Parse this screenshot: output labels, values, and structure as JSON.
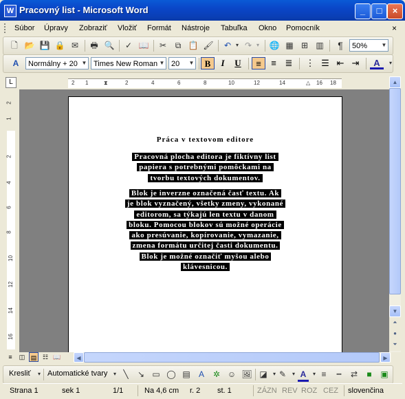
{
  "window": {
    "title": "Pracovný list - Microsoft Word",
    "app_icon": "W"
  },
  "menu": {
    "items": [
      {
        "label": "Súbor"
      },
      {
        "label": "Úpravy"
      },
      {
        "label": "Zobraziť"
      },
      {
        "label": "Vložiť"
      },
      {
        "label": "Formát"
      },
      {
        "label": "Nástroje"
      },
      {
        "label": "Tabuľka"
      },
      {
        "label": "Okno"
      },
      {
        "label": "Pomocník"
      }
    ],
    "close_doc": "×"
  },
  "standard_toolbar": {
    "zoom": "50%"
  },
  "formatting_toolbar": {
    "style": "Normálny + 20",
    "font": "Times New Roman",
    "size": "20",
    "bold": "B",
    "italic": "I",
    "underline": "U",
    "font_color": "#ff0000",
    "highlight_color": "#ffff00"
  },
  "ruler": {
    "h_ticks": [
      "2",
      "1",
      "2",
      "4",
      "6",
      "8",
      "10",
      "12",
      "14",
      "16",
      "18"
    ],
    "v_ticks": [
      "2",
      "1",
      "2",
      "4",
      "6",
      "8",
      "10",
      "12",
      "14",
      "16"
    ]
  },
  "document": {
    "title": "Práca v textovom editore",
    "para1": [
      "Pracovná plocha editora je fiktívny list",
      "papiera s potrebnými pomôckami na",
      "tvorbu textových dokumentov."
    ],
    "para2": [
      "Blok je inverzne označená časť textu. Ak",
      "je blok vyznačený, všetky zmeny, vykonané",
      "editorom, sa týkajú len textu v danom",
      "bloku. Pomocou blokov sú možné operácie",
      "ako presúvanie, kopírovanie, vymazanie,",
      "zmena formátu určitej časti dokumentu.",
      "Blok je možné označiť myšou alebo",
      "klávesnicou."
    ]
  },
  "drawing_toolbar": {
    "draw": "Kresliť",
    "autoshapes": "Automatické tvary"
  },
  "status": {
    "page": "Strana 1",
    "section": "sek 1",
    "pages": "1/1",
    "position": "Na 4,6 cm",
    "line": "r. 2",
    "column": "st. 1",
    "rec": "ZÁZN",
    "trk": "REV",
    "ext": "ROZ",
    "ovr": "CEZ",
    "language": "slovenčina"
  }
}
